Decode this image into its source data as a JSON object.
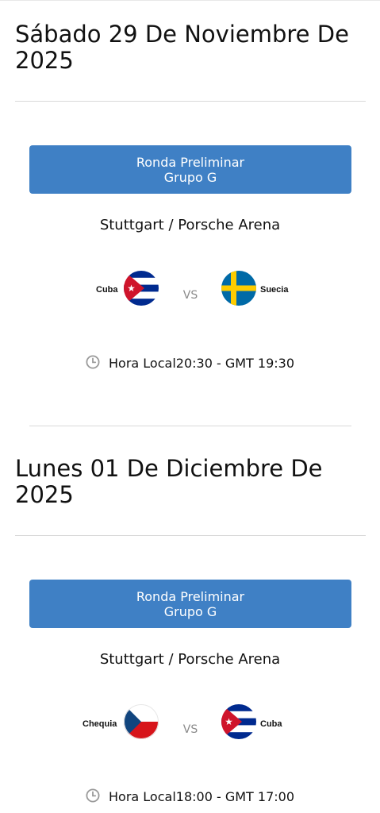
{
  "days": [
    {
      "date": "Sábado 29 De Noviembre De 2025",
      "match": {
        "round_line1": "Ronda Preliminar",
        "round_line2": "Grupo G",
        "venue": "Stuttgart / Porsche Arena",
        "home": {
          "name": "Cuba",
          "flag": "cuba-flag"
        },
        "vs": "VS",
        "away": {
          "name": "Suecia",
          "flag": "sweden-flag"
        },
        "time_label": "Hora Local",
        "time_value": "20:30 - GMT 19:30"
      }
    },
    {
      "date": "Lunes 01 De Diciembre De 2025",
      "match": {
        "round_line1": "Ronda Preliminar",
        "round_line2": "Grupo G",
        "venue": "Stuttgart / Porsche Arena",
        "home": {
          "name": "Chequia",
          "flag": "czechia-flag"
        },
        "vs": "VS",
        "away": {
          "name": "Cuba",
          "flag": "cuba-flag"
        },
        "time_label": "Hora Local",
        "time_value": "18:00 - GMT 17:00"
      }
    }
  ],
  "colors": {
    "button": "#3f80c5",
    "divider": "#d9d9d9",
    "vs_text": "#8a8a8a",
    "clock_icon": "#9a9a9a"
  },
  "icons": {
    "clock": "clock-icon"
  }
}
